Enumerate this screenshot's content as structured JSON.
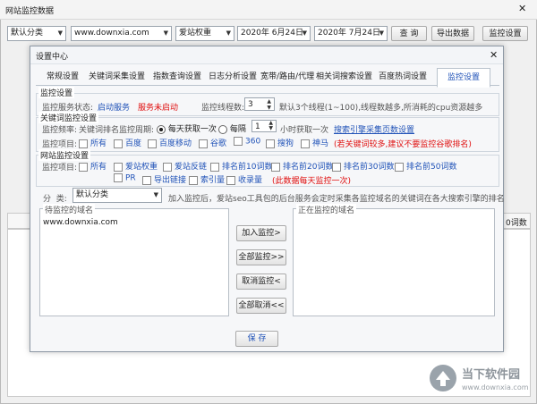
{
  "main_window": {
    "title": "网站监控数据",
    "close_glyph": "✕",
    "category_select": "默认分类",
    "site_select": "www.downxia.com",
    "metric_select": "爱站权重",
    "date_from": "2020年 6月24日",
    "date_to": "2020年 7月24日",
    "query_btn": "查 询",
    "export_btn": "导出数据",
    "settings_btn": "监控设置",
    "bg_cell_text": "0词数"
  },
  "dialog": {
    "title": "设置中心",
    "close_glyph": "✕",
    "tabs": [
      "常规设置",
      "关键词采集设置",
      "指数查询设置",
      "日志分析设置",
      "宽带/路由/代理",
      "相关词搜索设置",
      "百度热词设置",
      "监控设置"
    ],
    "active_tab": "监控设置",
    "monitor": {
      "legend": "监控设置",
      "status_label": "监控服务状态:",
      "start_link": "启动服务",
      "stop_status": "服务未启动",
      "threads_label": "监控线程数:",
      "threads_value": "3",
      "threads_note": "默认3个线程(1~100),线程数越多,所消耗的cpu资源越多"
    },
    "keyword": {
      "legend": "关键词监控设置",
      "freq_label": "监控频率:",
      "freq_desc": "关键词排名监控周期:",
      "daily_label": "每天获取一次",
      "every_label": "每隔",
      "hours_value": "1",
      "hours_suffix": "小时获取一次",
      "engine_link": "搜索引擎采集页数设置",
      "items_label": "监控项目:",
      "options": [
        "所有",
        "百度",
        "百度移动",
        "谷歌",
        "360",
        "搜狗",
        "神马"
      ],
      "warning": "(若关键词较多,建议不要监控谷歌排名)"
    },
    "site": {
      "legend": "网站监控设置",
      "items_label": "监控项目:",
      "row1": [
        "所有",
        "爱站权重",
        "爱站反链",
        "排名前10词数",
        "排名前20词数",
        "排名前30词数",
        "排名前50词数"
      ],
      "row2": [
        "PR",
        "导出链接",
        "索引量",
        "收录量"
      ],
      "warning": "(此数据每天监控一次)"
    },
    "category": {
      "label": "分  类:",
      "value": "默认分类",
      "note": "加入监控后，爱站seo工具包的后台服务会定时采集各监控域名的关键词在各大搜索引擎的排名"
    },
    "pending": {
      "legend": "待监控的域名",
      "items": [
        "www.downxia.com"
      ]
    },
    "active": {
      "legend": "正在监控的域名",
      "items": []
    },
    "buttons": {
      "add": "加入监控>",
      "add_all": "全部监控>>",
      "remove": "取消监控<",
      "remove_all": "全部取消<<",
      "save": "保 存"
    }
  },
  "watermark": {
    "brand": "当下软件园",
    "url": "www.downxia.com"
  }
}
